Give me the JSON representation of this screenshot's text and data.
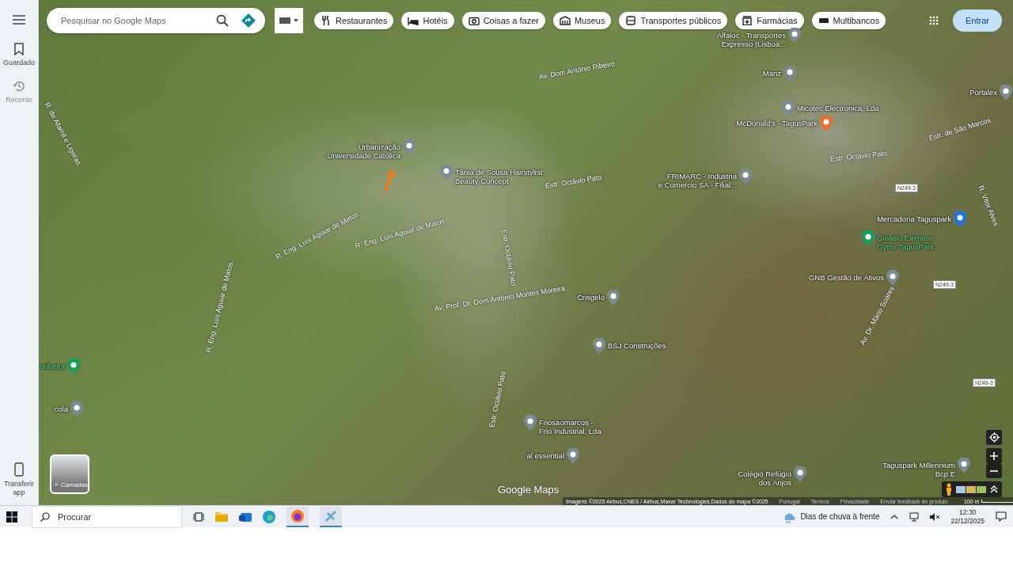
{
  "sidebar": {
    "items": [
      {
        "label": "Guardado",
        "disabled": false
      },
      {
        "label": "Recente",
        "disabled": true
      }
    ],
    "bottom_item": {
      "label": "Transferir app"
    }
  },
  "search": {
    "placeholder": "Pesquisar no Google Maps"
  },
  "chips": [
    {
      "label": "Restaurantes"
    },
    {
      "label": "Hotéis"
    },
    {
      "label": "Coisas a fazer"
    },
    {
      "label": "Museus"
    },
    {
      "label": "Transportes públicos"
    },
    {
      "label": "Farmácias"
    },
    {
      "label": "Multibancos"
    }
  ],
  "sign_in": "Entrar",
  "places": [
    {
      "lines": [
        "Alfaloc - Transportes",
        "Expresso (Lisboa..."
      ],
      "color": "#7b8a94"
    },
    {
      "lines": [
        "Manz"
      ],
      "color": "#7b8a94"
    },
    {
      "lines": [
        "Micotec Electronica, Lda"
      ],
      "color": "#7b8a94"
    },
    {
      "lines": [
        "McDonald's - TagusPark"
      ],
      "color": "#ef6c2a"
    },
    {
      "lines": [
        "Portalex"
      ],
      "color": "#7b8a94"
    },
    {
      "lines": [
        "Urbanização",
        "Universidade Católica"
      ],
      "color": "#7b8a94"
    },
    {
      "lines": [
        "Tânia de Sousa Hairstylist",
        "Beauty Concept"
      ],
      "color": "#7b8a94"
    },
    {
      "lines": [
        "FRIMARC - Industria",
        "e Comercio SA - Filial..."
      ],
      "color": "#7b8a94"
    },
    {
      "lines": [
        "Mercadona Taguspark"
      ],
      "color": "#1a73e8"
    },
    {
      "lines": [
        "Ginásio Element",
        "Gyms TagusPark"
      ],
      "color": "#16a05d"
    },
    {
      "lines": [
        "GNB Gestão de Ativos"
      ],
      "color": "#7b8a94"
    },
    {
      "lines": [
        "Crisgelo"
      ],
      "color": "#7b8a94"
    },
    {
      "lines": [
        "BSJ Construções"
      ],
      "color": "#7b8a94"
    },
    {
      "lines": [
        "Friosaomarcos -",
        "Frio Industrial, Lda"
      ],
      "color": "#7b8a94"
    },
    {
      "lines": [
        "al essential"
      ],
      "color": "#7b8a94"
    },
    {
      "lines": [
        "Colégio Refúgio",
        "dos Anjos"
      ],
      "color": "#7b8a94"
    },
    {
      "lines": [
        "Taguspark Millennium",
        "Bcp E"
      ],
      "color": "#7b8a94"
    },
    {
      "lines": [
        "stribeira"
      ],
      "color": "#16a05d"
    },
    {
      "lines": [
        "cola"
      ],
      "color": "#7b8a94"
    }
  ],
  "streets": [
    "Av. Dom António Ribeiro",
    "Estr. Octávio Pato",
    "Estr. Octávio Pato",
    "Estr. de São Marcos",
    "R. Vitor Alves",
    "R. Eng. Luís Aguiar de Matos",
    "R. Eng. Luís Aguiar de Matos",
    "R. Eng. Luís Aguiar de Matos",
    "Av. Prof. Dr. Dom António Montes Moreira",
    "Estr. Octávio Pato",
    "Estr. Octávio Pato",
    "Av. Dr. Mário Soares",
    "R. de Afamil e Ligeras"
  ],
  "road_shields": [
    "N249-3",
    "N249-3",
    "N249-3"
  ],
  "layers": {
    "label": "Camadas"
  },
  "logo": "Google Maps",
  "attribution": {
    "imagery": "Imagens ©2025 Airbus,CNES / Airbus,Maxar Technologies,Dados do mapa ©2025",
    "links": [
      "Portugal",
      "Termos",
      "Privacidade",
      "Enviar feedback do produto"
    ],
    "scale": "100 m"
  },
  "taskbar": {
    "search_placeholder": "Procurar",
    "weather": "Dias de chuva à frente",
    "time": "12:30",
    "date": "22/12/2025"
  }
}
